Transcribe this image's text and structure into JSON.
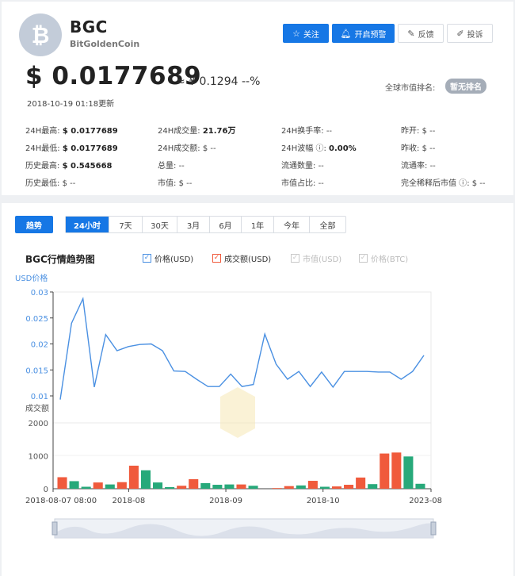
{
  "coin": {
    "logo_glyph": "₿",
    "symbol": "BGC",
    "name": "BitGoldenCoin"
  },
  "actions": {
    "follow": "关注",
    "alert": "开启预警",
    "feedback": "反馈",
    "report": "投诉"
  },
  "price": {
    "usd": "$ 0.0177689",
    "cny": "≈ ¥ 0.1294  --%",
    "updated": "2018-10-19 01:18更新"
  },
  "rank": {
    "label": "全球市值排名:",
    "value": "暂无排名"
  },
  "stats": {
    "high24_label": "24H最高:",
    "high24": "$ 0.0177689",
    "low24_label": "24H最低:",
    "low24": "$ 0.0177689",
    "ath_label": "历史最高:",
    "ath": "$ 0.545668",
    "atl_label": "历史最低:",
    "atl": "$ --",
    "vol24_label": "24H成交量:",
    "vol24": "21.76万",
    "amt24_label": "24H成交额:",
    "amt24": "$ --",
    "supply_label": "总量:",
    "supply": "--",
    "mcap_label": "市值:",
    "mcap": "$ --",
    "turnover_label": "24H换手率:",
    "turnover": "--",
    "amp_label": "24H波幅",
    "amp": "0.00%",
    "circ_label": "流通数量:",
    "circ": "--",
    "mcap_share_label": "市值占比:",
    "mcap_share": "--",
    "open_label": "昨开:",
    "open": "$ --",
    "close_label": "昨收:",
    "close": "$ --",
    "circ_rate_label": "流通率:",
    "circ_rate": "--",
    "fdv_label": "完全稀释后市值",
    "fdv": "$ --"
  },
  "tabs": {
    "trend": "趋势",
    "ranges": [
      "24小时",
      "7天",
      "30天",
      "3月",
      "6月",
      "1年",
      "今年",
      "全部"
    ],
    "active_range": "24小时"
  },
  "chart_title": "BGC行情趋势图",
  "legend": [
    {
      "label": "价格(USD)",
      "color": "#4a90e2",
      "checked": true
    },
    {
      "label": "成交额(USD)",
      "color": "#f05a3c",
      "checked": true
    },
    {
      "label": "市值(USD)",
      "color": "#c8c8c8",
      "checked": false
    },
    {
      "label": "价格(BTC)",
      "color": "#c8c8c8",
      "checked": false
    }
  ],
  "chart_data": {
    "type": "line",
    "price_axis_title": "USD价格",
    "volume_axis_title": "成交额",
    "price_ticks": [
      "0.03",
      "0.025",
      "0.02",
      "0.015",
      "0.01"
    ],
    "volume_ticks": [
      "2000",
      "1000",
      "0"
    ],
    "ylim_price": [
      0.01,
      0.03
    ],
    "ylim_volume": [
      0,
      2000
    ],
    "x_tick_labels": [
      "2018-08-07 08:00",
      "2018-08",
      "2018-09",
      "2018-10",
      "2023-08"
    ],
    "x_tick_positions": [
      0,
      7,
      16,
      25,
      35
    ],
    "series": [
      {
        "name": "价格(USD)",
        "color": "#4a90e2",
        "values": [
          0.0093,
          0.024,
          0.0287,
          0.0117,
          0.0218,
          0.0187,
          0.0195,
          0.0199,
          0.02,
          0.0187,
          0.0148,
          0.0147,
          0.0132,
          0.0118,
          0.0118,
          0.0142,
          0.0118,
          0.0122,
          0.0219,
          0.0161,
          0.0132,
          0.0147,
          0.0118,
          0.0146,
          0.0117,
          0.0147,
          0.0147,
          0.0147,
          0.0146,
          0.0146,
          0.0132,
          0.0147,
          0.0178
        ]
      },
      {
        "name": "成交额(USD)",
        "type": "bar",
        "values": [
          350,
          230,
          60,
          190,
          130,
          200,
          700,
          560,
          190,
          50,
          90,
          290,
          170,
          120,
          130,
          130,
          90,
          0,
          20,
          80,
          100,
          240,
          60,
          70,
          120,
          340,
          140,
          1070,
          1100,
          980,
          150
        ],
        "colors": [
          "r",
          "g",
          "g",
          "r",
          "g",
          "r",
          "r",
          "g",
          "g",
          "g",
          "r",
          "r",
          "g",
          "g",
          "g",
          "r",
          "g",
          "r",
          "r",
          "r",
          "g",
          "r",
          "g",
          "r",
          "r",
          "r",
          "g",
          "r",
          "r",
          "g",
          "g"
        ]
      }
    ]
  }
}
